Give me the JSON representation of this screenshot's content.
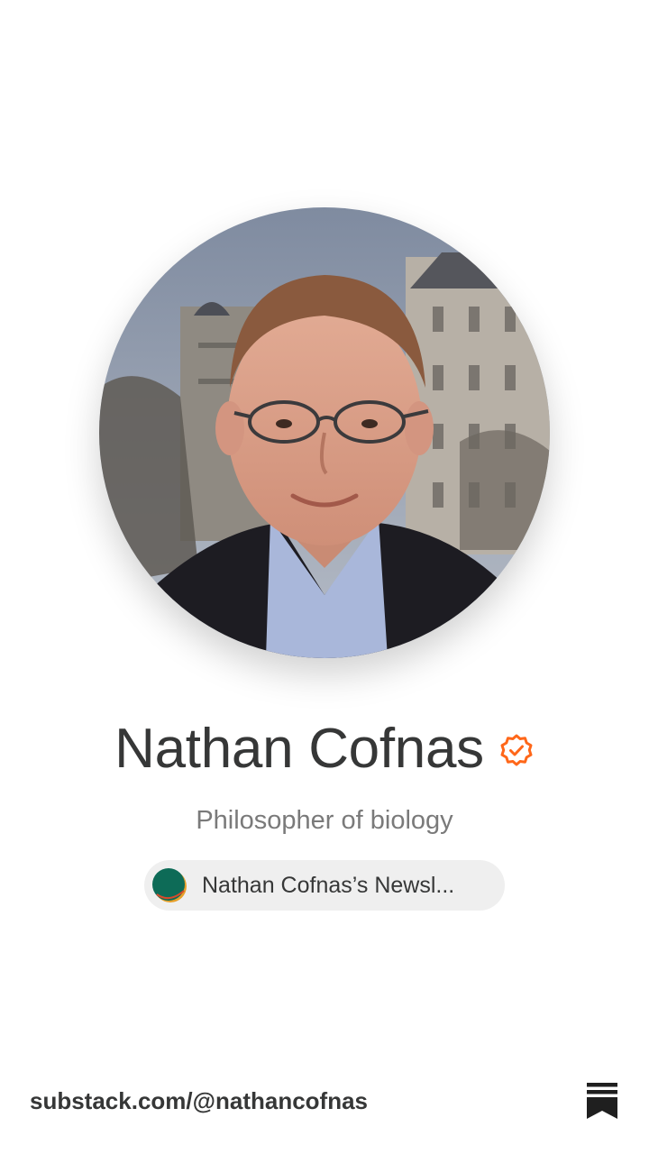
{
  "profile": {
    "photo_icon": "profile-photo",
    "name": "Nathan Cofnas",
    "verified_icon": "verified-badge-icon",
    "bio": "Philosopher of biology"
  },
  "publication": {
    "logo_icon": "publication-logo-icon",
    "name": "Nathan Cofnas’s Newsl..."
  },
  "footer": {
    "url": "substack.com/@nathancofnas",
    "brand_icon": "substack-logo-icon"
  },
  "colors": {
    "accent": "#ff6719",
    "text": "#363737",
    "muted": "#7a7a7a",
    "pill_bg": "#efefef"
  }
}
